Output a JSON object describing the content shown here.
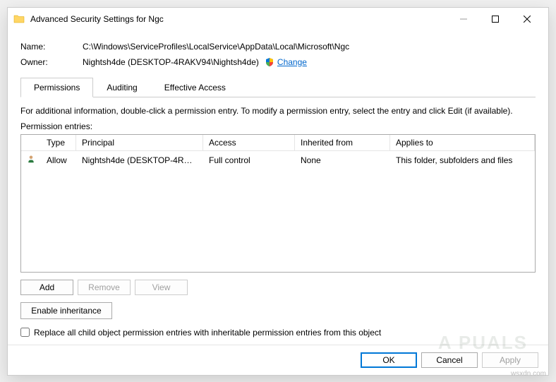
{
  "window": {
    "title": "Advanced Security Settings for Ngc"
  },
  "info": {
    "name_label": "Name:",
    "name_value": "C:\\Windows\\ServiceProfiles\\LocalService\\AppData\\Local\\Microsoft\\Ngc",
    "owner_label": "Owner:",
    "owner_value": "Nightsh4de (DESKTOP-4RAKV94\\Nightsh4de)",
    "change_link": "Change"
  },
  "tabs": {
    "permissions": "Permissions",
    "auditing": "Auditing",
    "effective": "Effective Access"
  },
  "permissions_tab": {
    "hint": "For additional information, double-click a permission entry. To modify a permission entry, select the entry and click Edit (if available).",
    "entries_label": "Permission entries:",
    "columns": {
      "type": "Type",
      "principal": "Principal",
      "access": "Access",
      "inherited": "Inherited from",
      "applies": "Applies to"
    },
    "rows": [
      {
        "type": "Allow",
        "principal": "Nightsh4de (DESKTOP-4RAKV...",
        "access": "Full control",
        "inherited": "None",
        "applies": "This folder, subfolders and files"
      }
    ],
    "buttons": {
      "add": "Add",
      "remove": "Remove",
      "view": "View"
    },
    "enable_inheritance": "Enable inheritance",
    "replace_label": "Replace all child object permission entries with inheritable permission entries from this object"
  },
  "footer": {
    "ok": "OK",
    "cancel": "Cancel",
    "apply": "Apply"
  },
  "watermark": "A   PUALS",
  "corner": "wsxdn.com"
}
